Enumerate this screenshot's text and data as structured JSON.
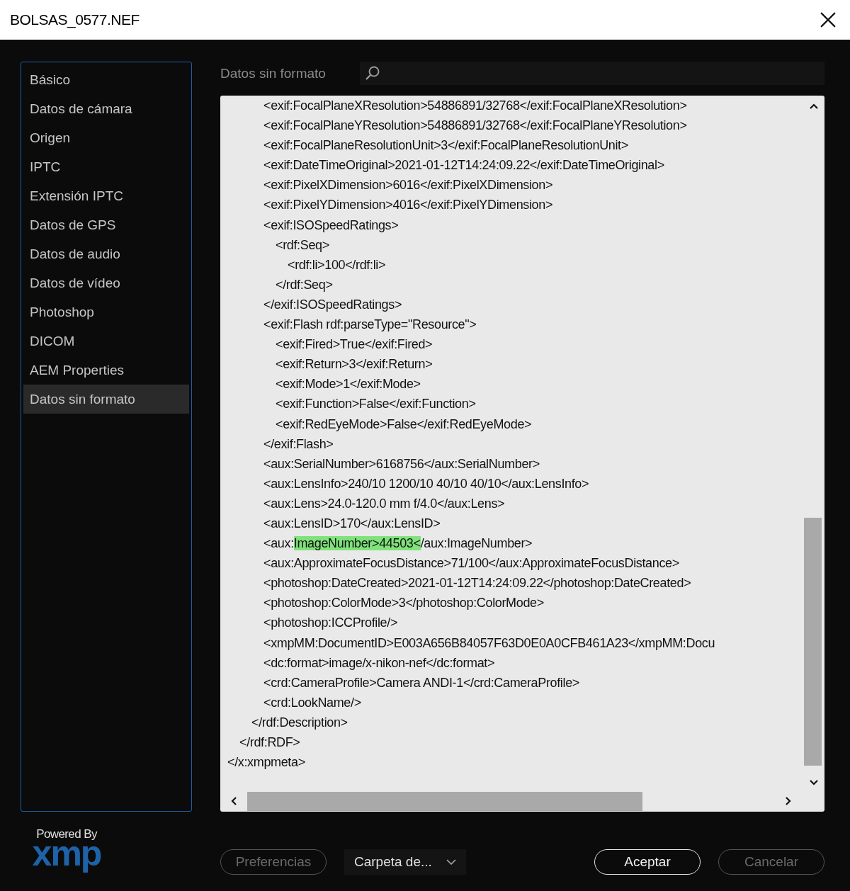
{
  "window": {
    "title": "BOLSAS_0577.NEF"
  },
  "sidebar": {
    "items": [
      {
        "label": "Básico",
        "selected": false
      },
      {
        "label": "Datos de cámara",
        "selected": false
      },
      {
        "label": "Origen",
        "selected": false
      },
      {
        "label": "IPTC",
        "selected": false
      },
      {
        "label": "Extensión IPTC",
        "selected": false
      },
      {
        "label": "Datos de GPS",
        "selected": false
      },
      {
        "label": "Datos de audio",
        "selected": false
      },
      {
        "label": "Datos de vídeo",
        "selected": false
      },
      {
        "label": "Photoshop",
        "selected": false
      },
      {
        "label": "DICOM",
        "selected": false
      },
      {
        "label": "AEM Properties",
        "selected": false
      },
      {
        "label": "Datos sin formato",
        "selected": true
      }
    ]
  },
  "panel": {
    "title": "Datos sin formato",
    "lines": [
      {
        "children": [
          {
            "children": [
              {
                "children": [
                  {
                    "text": "<exif:FocalPlaneXResolution>54886891/32768</exif:FocalPlaneXResolution>"
                  },
                  {
                    "text": "<exif:FocalPlaneYResolution>54886891/32768</exif:FocalPlaneYResolution>"
                  },
                  {
                    "text": "<exif:FocalPlaneResolutionUnit>3</exif:FocalPlaneResolutionUnit>"
                  },
                  {
                    "text": "<exif:DateTimeOriginal>2021-01-12T14:24:09.22</exif:DateTimeOriginal>"
                  },
                  {
                    "text": "<exif:PixelXDimension>6016</exif:PixelXDimension>"
                  },
                  {
                    "text": "<exif:PixelYDimension>4016</exif:PixelYDimension>"
                  },
                  {
                    "text": "<exif:ISOSpeedRatings>",
                    "children": [
                      {
                        "text": "<rdf:Seq>",
                        "children": [
                          {
                            "text": "<rdf:li>100</rdf:li>"
                          }
                        ]
                      },
                      {
                        "text": "</rdf:Seq>"
                      }
                    ]
                  },
                  {
                    "text": "</exif:ISOSpeedRatings>"
                  },
                  {
                    "text": "<exif:Flash rdf:parseType=\"Resource\">",
                    "children": [
                      {
                        "text": "<exif:Fired>True</exif:Fired>"
                      },
                      {
                        "text": "<exif:Return>3</exif:Return>"
                      },
                      {
                        "text": "<exif:Mode>1</exif:Mode>"
                      },
                      {
                        "text": "<exif:Function>False</exif:Function>"
                      },
                      {
                        "text": "<exif:RedEyeMode>False</exif:RedEyeMode>"
                      }
                    ]
                  },
                  {
                    "text": "</exif:Flash>"
                  },
                  {
                    "text": "<aux:SerialNumber>6168756</aux:SerialNumber>"
                  },
                  {
                    "text": "<aux:LensInfo>240/10 1200/10 40/10 40/10</aux:LensInfo>"
                  },
                  {
                    "text": "<aux:Lens>24.0-120.0 mm f/4.0</aux:Lens>"
                  },
                  {
                    "text": "<aux:LensID>170</aux:LensID>"
                  },
                  {
                    "parts": [
                      {
                        "text": "<aux:",
                        "highlighted": false
                      },
                      {
                        "text": "ImageNumber>44503<",
                        "highlighted": true
                      },
                      {
                        "text": "/aux:ImageNumber>",
                        "highlighted": false
                      }
                    ]
                  },
                  {
                    "text": "<aux:ApproximateFocusDistance>71/100</aux:ApproximateFocusDistance>"
                  },
                  {
                    "text": "<photoshop:DateCreated>2021-01-12T14:24:09.22</photoshop:DateCreated>"
                  },
                  {
                    "text": "<photoshop:ColorMode>3</photoshop:ColorMode>"
                  },
                  {
                    "text": "<photoshop:ICCProfile/>"
                  },
                  {
                    "text": "<xmpMM:DocumentID>E003A656B84057F63D0E0A0CFB461A23</xmpMM:Docu"
                  },
                  {
                    "text": "<dc:format>image/x-nikon-nef</dc:format>"
                  },
                  {
                    "text": "<crd:CameraProfile>Camera ANDI-1</crd:CameraProfile>"
                  },
                  {
                    "text": "<crd:LookName/>"
                  }
                ]
              },
              {
                "text": "</rdf:Description>"
              }
            ]
          },
          {
            "text": "</rdf:RDF>"
          }
        ]
      },
      {
        "text": "</x:xmpmeta>"
      }
    ]
  },
  "logo": {
    "caption": "Powered By",
    "wordmark": "xmp"
  },
  "buttons": [
    {
      "kind": "button",
      "label": "Preferencias",
      "disabled": true
    },
    {
      "kind": "dropdown",
      "label": "Carpeta de...",
      "disabled": false
    },
    {
      "kind": "spacer"
    },
    {
      "kind": "button",
      "label": "Aceptar",
      "disabled": false
    },
    {
      "kind": "button",
      "label": "Cancelar",
      "disabled": true
    }
  ]
}
